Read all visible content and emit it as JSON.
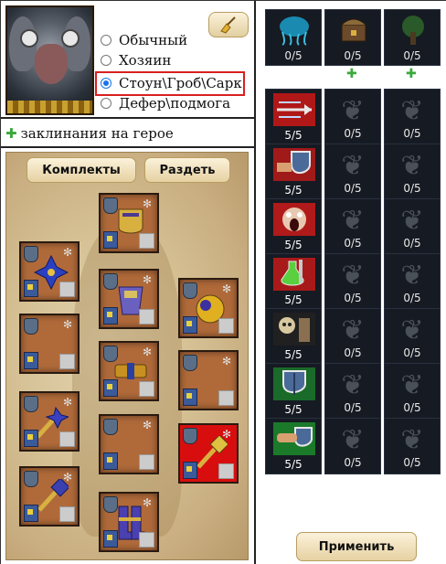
{
  "hero": {
    "options": [
      {
        "label": "Обычный",
        "selected": false
      },
      {
        "label": "Хозяин",
        "selected": false
      },
      {
        "label": "Стоун\\Гроб\\Сарк",
        "selected": true
      },
      {
        "label": "Дефер\\подмога",
        "selected": false
      }
    ],
    "clear_icon": "broom-icon"
  },
  "spells": {
    "label": "заклинания на герое",
    "icon": "plus-icon"
  },
  "equipment": {
    "sets_label": "Комплекты",
    "undress_label": "Раздеть",
    "slots": [
      {
        "name": "helmet",
        "icon": "helmet-icon"
      },
      {
        "name": "necklace",
        "icon": "cross-amulet-icon"
      },
      {
        "name": "armor",
        "icon": "armor-icon"
      },
      {
        "name": "shield",
        "icon": "orb-shield-icon"
      },
      {
        "name": "cloak",
        "icon": "empty-slot-icon"
      },
      {
        "name": "belt",
        "icon": "belt-icon"
      },
      {
        "name": "left-hand",
        "icon": "empty-slot-icon"
      },
      {
        "name": "weapon",
        "icon": "mace-icon"
      },
      {
        "name": "pants",
        "icon": "empty-slot-icon"
      },
      {
        "name": "ring",
        "icon": "empty-slot-icon"
      },
      {
        "name": "weapon-2",
        "icon": "hammer-icon",
        "highlight": "#d80e0e"
      },
      {
        "name": "rod",
        "icon": "hammer-icon"
      },
      {
        "name": "boots",
        "icon": "boots-icon"
      }
    ]
  },
  "artifacts": {
    "top": [
      {
        "count": "0/5",
        "icon": "jellyfish-icon"
      },
      {
        "count": "0/5",
        "icon": "chest-icon",
        "add_icon": "plus-icon"
      },
      {
        "count": "0/5",
        "icon": "tree-icon",
        "add_icon": "plus-icon"
      }
    ],
    "rows": [
      {
        "main": {
          "count": "5/5",
          "icon": "arrows-icon"
        },
        "c2": "0/5",
        "c3": "0/5"
      },
      {
        "main": {
          "count": "5/5",
          "icon": "shield-hand-icon"
        },
        "c2": "0/5",
        "c3": "0/5"
      },
      {
        "main": {
          "count": "5/5",
          "icon": "screaming-face-icon"
        },
        "c2": "0/5",
        "c3": "0/5"
      },
      {
        "main": {
          "count": "5/5",
          "icon": "potion-icon"
        },
        "c2": "0/5",
        "c3": "0/5"
      },
      {
        "main": {
          "count": "5/5",
          "icon": "skull-icon"
        },
        "c2": "0/5",
        "c3": "0/5"
      },
      {
        "main": {
          "count": "5/5",
          "icon": "shield-icon"
        },
        "c2": "0/5",
        "c3": "0/5"
      },
      {
        "main": {
          "count": "5/5",
          "icon": "handshake-shield-icon"
        },
        "c2": "0/5",
        "c3": "0/5"
      }
    ],
    "ghost_icon": "dark-glyph-icon"
  },
  "apply_label": "Применить"
}
